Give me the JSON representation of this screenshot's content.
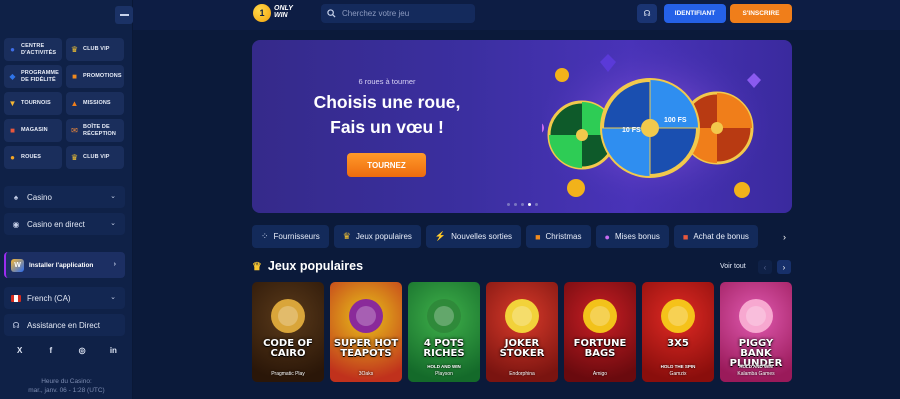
{
  "sidebar": {
    "tiles": [
      {
        "label": "Centre d'activités",
        "icon": "activity-center-icon",
        "color": "#3f6ee8",
        "glyph": "●"
      },
      {
        "label": "Club VIP",
        "icon": "crown-icon",
        "color": "#f7c531",
        "glyph": "♛"
      },
      {
        "label": "Programme de fidélité",
        "icon": "loyalty-icon",
        "color": "#2f74e8",
        "glyph": "◆"
      },
      {
        "label": "Promotions",
        "icon": "gift-icon",
        "color": "#f08a1e",
        "glyph": "■"
      },
      {
        "label": "Tournois",
        "icon": "trophy-icon",
        "color": "#f7b733",
        "glyph": "▼"
      },
      {
        "label": "Missions",
        "icon": "missions-icon",
        "color": "#f07e1a",
        "glyph": "▲"
      },
      {
        "label": "Magasin",
        "icon": "shop-icon",
        "color": "#e8573c",
        "glyph": "■"
      },
      {
        "label": "Boîte de réception",
        "icon": "inbox-icon",
        "color": "#f28a3a",
        "glyph": "✉"
      },
      {
        "label": "Roues",
        "icon": "wheel-icon",
        "color": "#f5a623",
        "glyph": "●"
      },
      {
        "label": "Club VIP",
        "icon": "crown-icon",
        "color": "#f7c531",
        "glyph": "♛"
      }
    ],
    "casino_label": "Casino",
    "live_label": "Casino en direct",
    "install_label": "Installer l'application",
    "language_label": "French (CA)",
    "support_label": "Assistance en Direct",
    "socials": [
      "X",
      "f",
      "◎",
      "in"
    ],
    "casino_time_title": "Heure du Casino:",
    "casino_time_value": "mar., janv. 06 - 1:28 (UTC)"
  },
  "header": {
    "logo_top": "ONLY",
    "logo_bottom": "WIN",
    "search_placeholder": "Cherchez votre jeu",
    "login_label": "IDENTIFIANT",
    "register_label": "S'INSCRIRE"
  },
  "banner": {
    "subtitle": "6 roues à tourner",
    "title_line1": "Choisis une roue,",
    "title_line2": "Fais un vœu !",
    "cta_label": "TOURNEZ",
    "slides": 5,
    "active_slide": 4
  },
  "categories": [
    {
      "label": "Fournisseurs",
      "icon": "providers-icon",
      "glyph": "⁘",
      "color": "#c9d4ee"
    },
    {
      "label": "Jeux populaires",
      "icon": "crown-icon",
      "glyph": "♛",
      "color": "#f7c531"
    },
    {
      "label": "Nouvelles sorties",
      "icon": "lightning-icon",
      "glyph": "⚡",
      "color": "#f7c531"
    },
    {
      "label": "Christmas",
      "icon": "gift-icon",
      "glyph": "■",
      "color": "#f08a1e"
    },
    {
      "label": "Mises bonus",
      "icon": "bonus-icon",
      "glyph": "●",
      "color": "#c86bf2"
    },
    {
      "label": "Achat de bonus",
      "icon": "gift-icon",
      "glyph": "■",
      "color": "#e8573c"
    }
  ],
  "popular": {
    "title": "Jeux populaires",
    "see_all": "Voir tout"
  },
  "games": [
    {
      "title": "CODE OF CAIRO",
      "subtitle": "",
      "provider": "Pragmatic Play",
      "bg1": "#5a3a1a",
      "bg2": "#2a1608",
      "motif": "#d9a53a"
    },
    {
      "title": "SUPER HOT TEAPOTS",
      "subtitle": "",
      "provider": "3Oaks",
      "bg1": "#e8c21a",
      "bg2": "#c0311c",
      "motif": "#8a2a9a"
    },
    {
      "title": "4 POTS RICHES",
      "subtitle": "HOLD AND WIN",
      "provider": "Playson",
      "bg1": "#3fb04a",
      "bg2": "#146a2a",
      "motif": "#2f8a3a"
    },
    {
      "title": "JOKER STOKER",
      "subtitle": "",
      "provider": "Endorphina",
      "bg1": "#d83a2a",
      "bg2": "#7a1410",
      "motif": "#f2d23a"
    },
    {
      "title": "FORTUNE BAGS",
      "subtitle": "",
      "provider": "Amigo",
      "bg1": "#c81e24",
      "bg2": "#6a0a0e",
      "motif": "#f2c21a"
    },
    {
      "title": "3X5",
      "subtitle": "HOLD THE SPIN",
      "provider": "Gamzix",
      "bg1": "#e02a24",
      "bg2": "#8a0e0c",
      "motif": "#f5c21a"
    },
    {
      "title": "PIGGY BANK PLUNDER",
      "subtitle": "HOLD AND WIN",
      "provider": "Kalamba Games",
      "bg1": "#e05ab0",
      "bg2": "#9a1a5a",
      "motif": "#f7a8d0"
    }
  ]
}
